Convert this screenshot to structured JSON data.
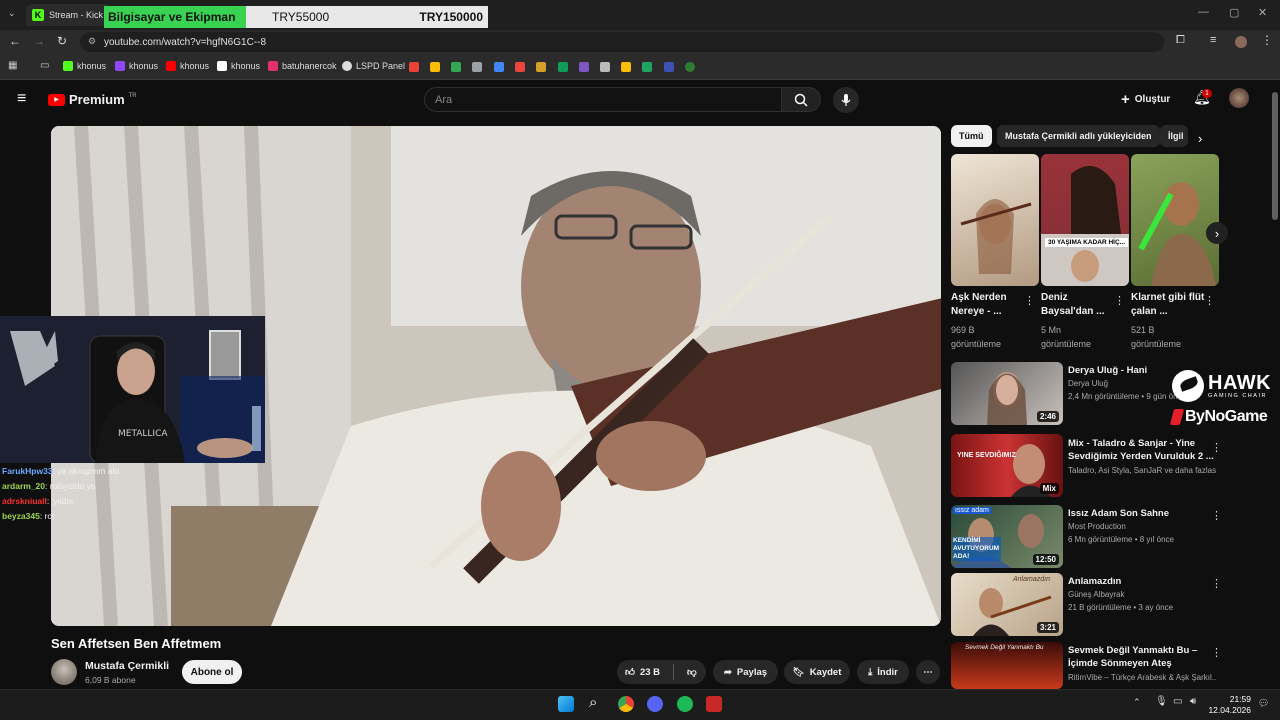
{
  "browser": {
    "tab_title": "Stream - Kick D",
    "url": "youtube.com/watch?v=hgfN6G1C--8"
  },
  "stream_overlay": {
    "label": "Bilgisayar ve Ekipman",
    "value1": "TRY55000",
    "value2": "TRY150000"
  },
  "bookmarks": [
    {
      "label": "khonus",
      "color": "#53fc18"
    },
    {
      "label": "khonus",
      "color": "#9146ff"
    },
    {
      "label": "khonus",
      "color": "#ff0000"
    },
    {
      "label": "khonus",
      "color": "#ffffff"
    },
    {
      "label": "batuhanercok",
      "color": "#e1306c"
    },
    {
      "label": "LSPD Panel",
      "color": "#dddddd"
    }
  ],
  "youtube": {
    "logo": "Premium",
    "logo_region": "TR",
    "search_placeholder": "Ara",
    "create_label": "Oluştur",
    "notification_count": "1"
  },
  "video": {
    "title": "Sen Affetsen Ben Affetmem",
    "channel": "Mustafa Çermikli",
    "subscribers": "6,09 B abone",
    "subscribe_label": "Abone ol",
    "likes": "23 B",
    "share_label": "Paylaş",
    "save_label": "Kaydet",
    "download_label": "İndir"
  },
  "chat": [
    {
      "user": "FarukHpw33",
      "color": "#6aa9ff",
      "text": ": ya aknqzmm abi"
    },
    {
      "user": "ardarm_20",
      "color": "#9bd64a",
      "text": ": rolüyüldü ya"
    },
    {
      "user": "adrskniuall",
      "color": "#ff3030",
      "text": ": 'yıldıs"
    },
    {
      "user": "beyza345",
      "color": "#9bd64a",
      "text": ": rol"
    }
  ],
  "chips": [
    "Tümü",
    "Mustafa Çermikli adlı yükleyiciden",
    "İlgil"
  ],
  "shorts": [
    {
      "title": "Aşk Nerden Nereye - ...",
      "views": "969 B görüntüleme",
      "overlay": ""
    },
    {
      "title": "Deniz Baysal'dan ...",
      "views": "5 Mn görüntüleme",
      "overlay": "30 YAŞIMA KADAR HİÇ..."
    },
    {
      "title": "Klarnet gibi flüt çalan ...",
      "views": "521 B görüntüleme",
      "overlay": ""
    }
  ],
  "related": [
    {
      "title": "Derya Uluğ - Hani",
      "channel": "Derya Uluğ",
      "meta": "2,4 Mn görüntüleme • 9 gün önce",
      "duration": "2:46"
    },
    {
      "title": "Mix - Taladro & Sanjar - Yine Sevdiğimiz Yerden Vurulduk 2 ...",
      "channel": "Taladro, Asi Styla, SanJaR ve daha fazlası",
      "meta": "",
      "duration": "Mix"
    },
    {
      "title": "Issız Adam Son Sahne",
      "channel": "Most Production",
      "meta": "6 Mn görüntüleme • 8 yıl önce",
      "duration": "12:50"
    },
    {
      "title": "Anlamazdın",
      "channel": "Güneş Albayrak",
      "meta": "21 B görüntüleme • 3 ay önce",
      "duration": "3:21"
    },
    {
      "title": "Sevmek Değil Yanmaktı Bu – İçimde Sönmeyen Ateş",
      "channel": "RitimVibe – Türkçe Arabesk & Aşk Şarkıl...",
      "meta": "",
      "duration": ""
    }
  ],
  "sponsor": {
    "line1": "HAWK",
    "line2": "GAMING CHAIR",
    "line3": "ByNoGame"
  },
  "related_thumb_text": {
    "t2": "YINE SEVDIĞIMIZ",
    "t3a": "ıssız adam",
    "t3b": "KENDİMİ AVUTUYORUM ADA!",
    "t4": "Anlamazdın",
    "t5": "Sevmek Değil Yanmaktı Bu"
  },
  "clock": {
    "time": "21:59",
    "date": "12.04.2026"
  }
}
